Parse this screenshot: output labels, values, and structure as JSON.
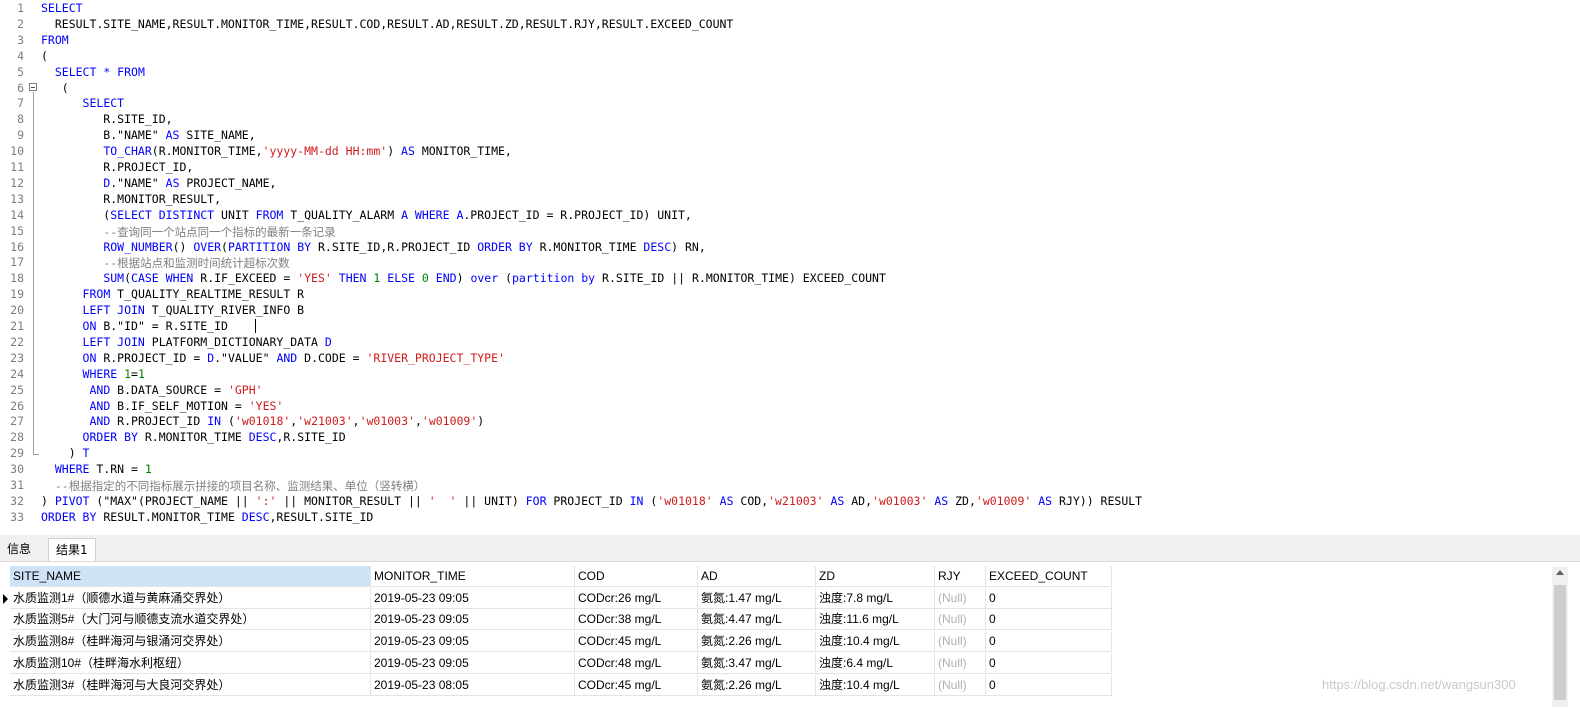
{
  "editor": {
    "lines": [
      {
        "n": "1",
        "tokens": [
          {
            "t": "SELECT",
            "c": "k"
          }
        ]
      },
      {
        "n": "2",
        "tokens": [
          {
            "t": "  RESULT.SITE_NAME,RESULT.MONITOR_TIME,RESULT.COD,RESULT.AD,RESULT.ZD,RESULT.RJY,RESULT.EXCEED_COUNT",
            "c": "p"
          }
        ]
      },
      {
        "n": "3",
        "tokens": [
          {
            "t": "FROM",
            "c": "k"
          }
        ]
      },
      {
        "n": "4",
        "tokens": [
          {
            "t": "(",
            "c": "p"
          }
        ]
      },
      {
        "n": "5",
        "tokens": [
          {
            "t": "  ",
            "c": "p"
          },
          {
            "t": "SELECT * FROM",
            "c": "k"
          }
        ]
      },
      {
        "n": "6",
        "tokens": [
          {
            "t": "   (",
            "c": "p"
          }
        ]
      },
      {
        "n": "7",
        "tokens": [
          {
            "t": "      ",
            "c": "p"
          },
          {
            "t": "SELECT",
            "c": "k"
          }
        ]
      },
      {
        "n": "8",
        "tokens": [
          {
            "t": "         R.SITE_ID,",
            "c": "p"
          }
        ]
      },
      {
        "n": "9",
        "tokens": [
          {
            "t": "         B.\"NAME\" ",
            "c": "p"
          },
          {
            "t": "AS",
            "c": "k"
          },
          {
            "t": " SITE_NAME,",
            "c": "p"
          }
        ]
      },
      {
        "n": "10",
        "tokens": [
          {
            "t": "         ",
            "c": "p"
          },
          {
            "t": "TO_CHAR",
            "c": "k"
          },
          {
            "t": "(R.MONITOR_TIME,",
            "c": "p"
          },
          {
            "t": "'yyyy-MM-dd HH:mm'",
            "c": "s"
          },
          {
            "t": ") ",
            "c": "p"
          },
          {
            "t": "AS",
            "c": "k"
          },
          {
            "t": " MONITOR_TIME,",
            "c": "p"
          }
        ]
      },
      {
        "n": "11",
        "tokens": [
          {
            "t": "         R.PROJECT_ID,",
            "c": "p"
          }
        ]
      },
      {
        "n": "12",
        "tokens": [
          {
            "t": "         ",
            "c": "p"
          },
          {
            "t": "D",
            "c": "k"
          },
          {
            "t": ".\"NAME\" ",
            "c": "p"
          },
          {
            "t": "AS",
            "c": "k"
          },
          {
            "t": " PROJECT_NAME,",
            "c": "p"
          }
        ]
      },
      {
        "n": "13",
        "tokens": [
          {
            "t": "         R.MONITOR_RESULT,",
            "c": "p"
          }
        ]
      },
      {
        "n": "14",
        "tokens": [
          {
            "t": "         (",
            "c": "p"
          },
          {
            "t": "SELECT DISTINCT",
            "c": "k"
          },
          {
            "t": " UNIT ",
            "c": "p"
          },
          {
            "t": "FROM",
            "c": "k"
          },
          {
            "t": " T_QUALITY_ALARM ",
            "c": "p"
          },
          {
            "t": "A WHERE A",
            "c": "k"
          },
          {
            "t": ".PROJECT_ID = R.PROJECT_ID) UNIT,",
            "c": "p"
          }
        ]
      },
      {
        "n": "15",
        "tokens": [
          {
            "t": "         ",
            "c": "p"
          },
          {
            "t": "--查询同一个站点同一个指标的最新一条记录",
            "c": "c"
          }
        ]
      },
      {
        "n": "16",
        "tokens": [
          {
            "t": "         ",
            "c": "p"
          },
          {
            "t": "ROW_NUMBER",
            "c": "k"
          },
          {
            "t": "() ",
            "c": "p"
          },
          {
            "t": "OVER",
            "c": "k"
          },
          {
            "t": "(",
            "c": "p"
          },
          {
            "t": "PARTITION BY",
            "c": "k"
          },
          {
            "t": " R.SITE_ID,R.PROJECT_ID ",
            "c": "p"
          },
          {
            "t": "ORDER BY",
            "c": "k"
          },
          {
            "t": " R.MONITOR_TIME ",
            "c": "p"
          },
          {
            "t": "DESC",
            "c": "k"
          },
          {
            "t": ") RN,",
            "c": "p"
          }
        ]
      },
      {
        "n": "17",
        "tokens": [
          {
            "t": "         ",
            "c": "p"
          },
          {
            "t": "--根据站点和监测时间统计超标次数",
            "c": "c"
          }
        ]
      },
      {
        "n": "18",
        "tokens": [
          {
            "t": "         ",
            "c": "p"
          },
          {
            "t": "SUM",
            "c": "k"
          },
          {
            "t": "(",
            "c": "p"
          },
          {
            "t": "CASE WHEN",
            "c": "k"
          },
          {
            "t": " R.IF_EXCEED = ",
            "c": "p"
          },
          {
            "t": "'YES'",
            "c": "s"
          },
          {
            "t": " ",
            "c": "p"
          },
          {
            "t": "THEN",
            "c": "k"
          },
          {
            "t": " ",
            "c": "p"
          },
          {
            "t": "1",
            "c": "n"
          },
          {
            "t": " ",
            "c": "p"
          },
          {
            "t": "ELSE",
            "c": "k"
          },
          {
            "t": " ",
            "c": "p"
          },
          {
            "t": "0",
            "c": "n"
          },
          {
            "t": " ",
            "c": "p"
          },
          {
            "t": "END",
            "c": "k"
          },
          {
            "t": ") ",
            "c": "p"
          },
          {
            "t": "over",
            "c": "k"
          },
          {
            "t": " (",
            "c": "p"
          },
          {
            "t": "partition by",
            "c": "k"
          },
          {
            "t": " R.SITE_ID || R.MONITOR_TIME) EXCEED_COUNT",
            "c": "p"
          }
        ]
      },
      {
        "n": "19",
        "tokens": [
          {
            "t": "      ",
            "c": "p"
          },
          {
            "t": "FROM",
            "c": "k"
          },
          {
            "t": " T_QUALITY_REALTIME_RESULT R",
            "c": "p"
          }
        ]
      },
      {
        "n": "20",
        "tokens": [
          {
            "t": "      ",
            "c": "p"
          },
          {
            "t": "LEFT JOIN",
            "c": "k"
          },
          {
            "t": " T_QUALITY_RIVER_INFO B",
            "c": "p"
          }
        ]
      },
      {
        "n": "21",
        "tokens": [
          {
            "t": "      ",
            "c": "p"
          },
          {
            "t": "ON",
            "c": "k"
          },
          {
            "t": " B.\"ID\" = R.SITE_ID",
            "c": "p"
          }
        ]
      },
      {
        "n": "22",
        "tokens": [
          {
            "t": "      ",
            "c": "p"
          },
          {
            "t": "LEFT JOIN",
            "c": "k"
          },
          {
            "t": " PLATFORM_DICTIONARY_DATA ",
            "c": "p"
          },
          {
            "t": "D",
            "c": "k"
          }
        ]
      },
      {
        "n": "23",
        "tokens": [
          {
            "t": "      ",
            "c": "p"
          },
          {
            "t": "ON",
            "c": "k"
          },
          {
            "t": " R.PROJECT_ID = ",
            "c": "p"
          },
          {
            "t": "D",
            "c": "k"
          },
          {
            "t": ".\"VALUE\" ",
            "c": "p"
          },
          {
            "t": "AND",
            "c": "k"
          },
          {
            "t": " D.CODE = ",
            "c": "p"
          },
          {
            "t": "'RIVER_PROJECT_TYPE'",
            "c": "s"
          }
        ]
      },
      {
        "n": "24",
        "tokens": [
          {
            "t": "      ",
            "c": "p"
          },
          {
            "t": "WHERE",
            "c": "k"
          },
          {
            "t": " ",
            "c": "p"
          },
          {
            "t": "1",
            "c": "n"
          },
          {
            "t": "=",
            "c": "p"
          },
          {
            "t": "1",
            "c": "n"
          }
        ]
      },
      {
        "n": "25",
        "tokens": [
          {
            "t": "       ",
            "c": "p"
          },
          {
            "t": "AND",
            "c": "k"
          },
          {
            "t": " B.DATA_SOURCE = ",
            "c": "p"
          },
          {
            "t": "'GPH'",
            "c": "s"
          }
        ]
      },
      {
        "n": "26",
        "tokens": [
          {
            "t": "       ",
            "c": "p"
          },
          {
            "t": "AND",
            "c": "k"
          },
          {
            "t": " B.IF_SELF_MOTION = ",
            "c": "p"
          },
          {
            "t": "'YES'",
            "c": "s"
          }
        ]
      },
      {
        "n": "27",
        "tokens": [
          {
            "t": "       ",
            "c": "p"
          },
          {
            "t": "AND",
            "c": "k"
          },
          {
            "t": " R.PROJECT_ID ",
            "c": "p"
          },
          {
            "t": "IN",
            "c": "k"
          },
          {
            "t": " (",
            "c": "p"
          },
          {
            "t": "'w01018'",
            "c": "s"
          },
          {
            "t": ",",
            "c": "p"
          },
          {
            "t": "'w21003'",
            "c": "s"
          },
          {
            "t": ",",
            "c": "p"
          },
          {
            "t": "'w01003'",
            "c": "s"
          },
          {
            "t": ",",
            "c": "p"
          },
          {
            "t": "'w01009'",
            "c": "s"
          },
          {
            "t": ")",
            "c": "p"
          }
        ]
      },
      {
        "n": "28",
        "tokens": [
          {
            "t": "      ",
            "c": "p"
          },
          {
            "t": "ORDER BY",
            "c": "k"
          },
          {
            "t": " R.MONITOR_TIME ",
            "c": "p"
          },
          {
            "t": "DESC",
            "c": "k"
          },
          {
            "t": ",R.SITE_ID",
            "c": "p"
          }
        ]
      },
      {
        "n": "29",
        "tokens": [
          {
            "t": "    ) ",
            "c": "p"
          },
          {
            "t": "T",
            "c": "k"
          }
        ]
      },
      {
        "n": "30",
        "tokens": [
          {
            "t": "  ",
            "c": "p"
          },
          {
            "t": "WHERE",
            "c": "k"
          },
          {
            "t": " T.RN = ",
            "c": "p"
          },
          {
            "t": "1",
            "c": "n"
          }
        ]
      },
      {
        "n": "31",
        "tokens": [
          {
            "t": "  ",
            "c": "p"
          },
          {
            "t": "--根据指定的不同指标展示拼接的项目名称、监测结果、单位（竖转横）",
            "c": "c"
          }
        ]
      },
      {
        "n": "32",
        "tokens": [
          {
            "t": ") ",
            "c": "p"
          },
          {
            "t": "PIVOT",
            "c": "k"
          },
          {
            "t": " (\"MAX\"(PROJECT_NAME || ",
            "c": "p"
          },
          {
            "t": "':'",
            "c": "s"
          },
          {
            "t": " || MONITOR_RESULT || ",
            "c": "p"
          },
          {
            "t": "'  '",
            "c": "s"
          },
          {
            "t": " || UNIT) ",
            "c": "p"
          },
          {
            "t": "FOR",
            "c": "k"
          },
          {
            "t": " PROJECT_ID ",
            "c": "p"
          },
          {
            "t": "IN",
            "c": "k"
          },
          {
            "t": " (",
            "c": "p"
          },
          {
            "t": "'w01018'",
            "c": "s"
          },
          {
            "t": " ",
            "c": "p"
          },
          {
            "t": "AS",
            "c": "k"
          },
          {
            "t": " COD,",
            "c": "p"
          },
          {
            "t": "'w21003'",
            "c": "s"
          },
          {
            "t": " ",
            "c": "p"
          },
          {
            "t": "AS",
            "c": "k"
          },
          {
            "t": " AD,",
            "c": "p"
          },
          {
            "t": "'w01003'",
            "c": "s"
          },
          {
            "t": " ",
            "c": "p"
          },
          {
            "t": "AS",
            "c": "k"
          },
          {
            "t": " ZD,",
            "c": "p"
          },
          {
            "t": "'w01009'",
            "c": "s"
          },
          {
            "t": " ",
            "c": "p"
          },
          {
            "t": "AS",
            "c": "k"
          },
          {
            "t": " RJY)) RESULT",
            "c": "p"
          }
        ]
      },
      {
        "n": "33",
        "tokens": [
          {
            "t": "ORDER BY",
            "c": "k"
          },
          {
            "t": " RESULT.MONITOR_TIME ",
            "c": "p"
          },
          {
            "t": "DESC",
            "c": "k"
          },
          {
            "t": ",RESULT.SITE_ID",
            "c": "p"
          }
        ]
      }
    ]
  },
  "tabs": {
    "info": "信息",
    "result": "结果1"
  },
  "grid": {
    "columns": [
      "SITE_NAME",
      "MONITOR_TIME",
      "COD",
      "AD",
      "ZD",
      "RJY",
      "EXCEED_COUNT"
    ],
    "rows": [
      [
        "水质监测1#（顺德水道与黄麻涌交界处）",
        "2019-05-23 09:05",
        "CODcr:26  mg/L",
        "氨氮:1.47  mg/L",
        "浊度:7.8  mg/L",
        "(Null)",
        "0"
      ],
      [
        "水质监测5#（大门河与顺德支流水道交界处）",
        "2019-05-23 09:05",
        "CODcr:38  mg/L",
        "氨氮:4.47  mg/L",
        "浊度:11.6  mg/L",
        "(Null)",
        "0"
      ],
      [
        "水质监测8#（桂畔海河与银涌河交界处）",
        "2019-05-23 09:05",
        "CODcr:45  mg/L",
        "氨氮:2.26  mg/L",
        "浊度:10.4  mg/L",
        "(Null)",
        "0"
      ],
      [
        "水质监测10#（桂畔海水利枢纽）",
        "2019-05-23 09:05",
        "CODcr:48  mg/L",
        "氨氮:3.47  mg/L",
        "浊度:6.4  mg/L",
        "(Null)",
        "0"
      ],
      [
        "水质监测3#（桂畔海河与大良河交界处）",
        "2019-05-23 08:05",
        "CODcr:45  mg/L",
        "氨氮:2.26  mg/L",
        "浊度:10.4  mg/L",
        "(Null)",
        "0"
      ]
    ]
  },
  "watermark": "https://blog.csdn.net/wangsun300"
}
